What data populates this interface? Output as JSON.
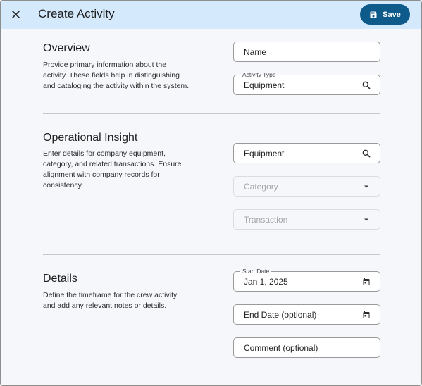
{
  "header": {
    "title": "Create Activity",
    "save_label": "Save"
  },
  "overview": {
    "title": "Overview",
    "description": "Provide primary information about the activity. These fields help in distinguishing and cataloging the activity within the system.",
    "name_placeholder": "Name",
    "activity_type_label": "Activity Type",
    "activity_type_value": "Equipment"
  },
  "operational": {
    "title": "Operational Insight",
    "description": "Enter details for company equipment, category, and related transactions. Ensure alignment with company records for consistency.",
    "equipment_value": "Equipment",
    "category_placeholder": "Category",
    "transaction_placeholder": "Transaction"
  },
  "details": {
    "title": "Details",
    "description": "Define the timeframe for the crew activity and add any relevant notes or details.",
    "start_date_label": "Start Date",
    "start_date_value": "Jan 1, 2025",
    "end_date_placeholder": "End Date (optional)",
    "comment_placeholder": "Comment (optional)"
  },
  "icons": {
    "close": "close-icon",
    "save": "save-icon",
    "search": "search-icon",
    "dropdown": "arrow-drop-down-icon",
    "calendar": "calendar-icon"
  },
  "colors": {
    "header_bg": "#d4e9fb",
    "primary": "#0e5a8a",
    "page_bg": "#f6f7fb"
  }
}
